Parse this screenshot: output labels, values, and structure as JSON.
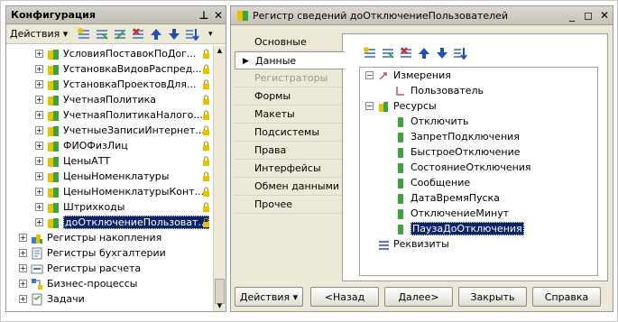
{
  "config_panel": {
    "title": "Конфигурация",
    "actions_label": "Действия",
    "tree_items": [
      {
        "label": "УсловияПоставокПоДог..."
      },
      {
        "label": "УстановкаВидовРаспред..."
      },
      {
        "label": "УстановкаПроектовДля..."
      },
      {
        "label": "УчетнаяПолитика"
      },
      {
        "label": "УчетнаяПолитикаНалого..."
      },
      {
        "label": "УчетныеЗаписиИнтернет..."
      },
      {
        "label": "ФИОФизЛиц"
      },
      {
        "label": "ЦеныАТТ"
      },
      {
        "label": "ЦеныНоменклатуры"
      },
      {
        "label": "ЦеныНоменклатурыКонт..."
      },
      {
        "label": "Штрихкоды"
      },
      {
        "label": "доОтключениеПользоват..."
      }
    ],
    "root_items": [
      {
        "label": "Регистры накопления"
      },
      {
        "label": "Регистры бухгалтерии"
      },
      {
        "label": "Регистры расчета"
      },
      {
        "label": "Бизнес-процессы"
      },
      {
        "label": "Задачи"
      }
    ]
  },
  "register_window": {
    "title": "Регистр сведений доОтключениеПользователей",
    "tabs": [
      {
        "label": "Основные"
      },
      {
        "label": "Данные"
      },
      {
        "label": "Регистраторы"
      },
      {
        "label": "Формы"
      },
      {
        "label": "Макеты"
      },
      {
        "label": "Подсистемы"
      },
      {
        "label": "Права"
      },
      {
        "label": "Интерфейсы"
      },
      {
        "label": "Обмен данными"
      },
      {
        "label": "Прочее"
      }
    ],
    "tree": {
      "dimensions": "Измерения",
      "dimension_items": [
        "Пользователь"
      ],
      "resources": "Ресурсы",
      "resource_items": [
        "Отключить",
        "ЗапретПодключения",
        "БыстроеОтключение",
        "СостояниеОтключения",
        "Сообщение",
        "ДатаВремяПуска",
        "ОтключениеМинут",
        "ПаузаДоОтключения"
      ],
      "requisites": "Реквизиты"
    },
    "buttons": {
      "actions": "Действия",
      "back": "<Назад",
      "next": "Далее>",
      "close": "Закрыть",
      "help": "Справка"
    }
  },
  "colors": {
    "selection": "#0a246a",
    "icon_yellow": "#e8c200",
    "icon_green": "#3aa53a",
    "arrow_blue": "#1f4fb8"
  }
}
